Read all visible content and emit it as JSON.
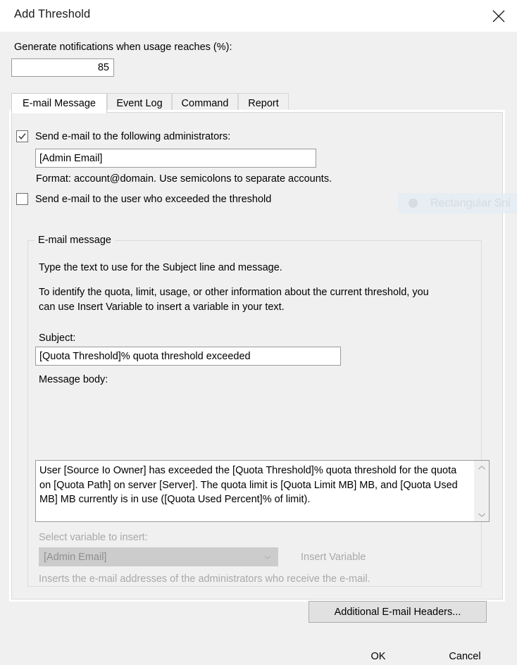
{
  "window": {
    "title": "Add Threshold",
    "close_icon": "close-icon"
  },
  "threshold": {
    "label": "Generate notifications when usage reaches (%):",
    "value": "85"
  },
  "tabs": [
    {
      "label": "E-mail Message",
      "active": true
    },
    {
      "label": "Event Log",
      "active": false
    },
    {
      "label": "Command",
      "active": false
    },
    {
      "label": "Report",
      "active": false
    }
  ],
  "email_tab": {
    "send_admins_checkbox": {
      "label": "Send e-mail to the following administrators:",
      "checked": true
    },
    "admin_email": {
      "value": "[Admin Email]",
      "placeholder": ""
    },
    "format_hint": "Format: account@domain. Use semicolons to separate accounts.",
    "send_user_checkbox": {
      "label": "Send e-mail to the user who exceeded the threshold",
      "checked": false
    },
    "group": {
      "title": "E-mail message",
      "intro_line": "Type the text to use for the Subject line and message.",
      "variable_help_line1": "To identify the quota, limit, usage, or other information about the current threshold, you",
      "variable_help_line2": "can use Insert Variable to insert a variable in your text.",
      "subject_label": "Subject:",
      "subject_value": "[Quota Threshold]% quota threshold exceeded",
      "message_body_label": "Message body:",
      "message_body_value": "User [Source Io Owner] has exceeded the [Quota Threshold]% quota threshold for the quota on [Quota Path] on server [Server]. The quota limit is [Quota Limit MB] MB, and [Quota Used MB] MB currently is in use ([Quota Used Percent]% of limit).",
      "select_variable_label": "Select variable to insert:",
      "selected_variable": "[Admin Email]",
      "insert_variable_button": "Insert Variable",
      "variable_description": "Inserts the e-mail addresses of the administrators who receive the e-mail.",
      "scroll_up_icon": "chevron-up-icon",
      "scroll_down_icon": "chevron-down-icon",
      "combo_arrow_icon": "chevron-down-icon"
    },
    "additional_headers_button": "Additional E-mail Headers..."
  },
  "footer": {
    "ok_label": "OK",
    "cancel_label": "Cancel"
  },
  "overlay": {
    "snip_label": "Rectangular Sni",
    "dot_icon": "circle-icon"
  },
  "colors": {
    "dialog_bg": "#f0f0f0",
    "titlebar_bg": "#ffffff",
    "field_bg": "#ffffff",
    "field_border": "#999a9b",
    "disabled_text": "#a8a8a8",
    "combo_disabled_bg": "#cccccc",
    "button_bg": "#e1e1e1",
    "button_border": "#adadad"
  }
}
